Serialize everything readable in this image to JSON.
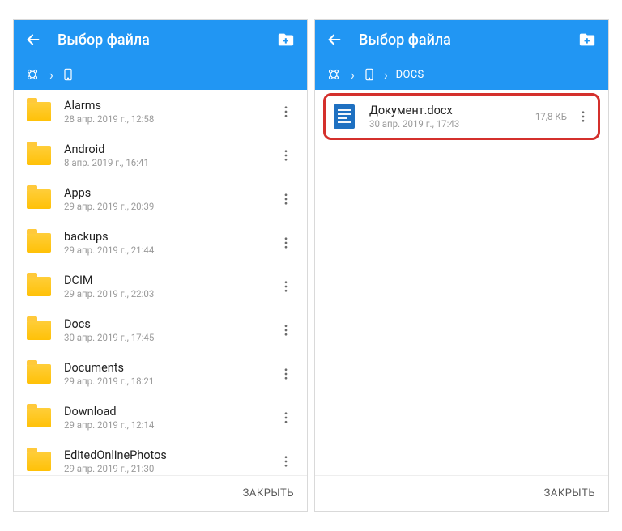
{
  "left": {
    "title": "Выбор файла",
    "breadcrumb": {
      "segments": []
    },
    "items": [
      {
        "name": "Alarms",
        "date": "28 апр. 2019 г., 12:58",
        "type": "folder"
      },
      {
        "name": "Android",
        "date": "8 апр. 2019 г., 16:41",
        "type": "folder"
      },
      {
        "name": "Apps",
        "date": "29 апр. 2019 г., 20:39",
        "type": "folder"
      },
      {
        "name": "backups",
        "date": "29 апр. 2019 г., 21:44",
        "type": "folder"
      },
      {
        "name": "DCIM",
        "date": "29 апр. 2019 г., 22:03",
        "type": "folder"
      },
      {
        "name": "Docs",
        "date": "30 апр. 2019 г., 17:45",
        "type": "folder"
      },
      {
        "name": "Documents",
        "date": "29 апр. 2019 г., 18:21",
        "type": "folder"
      },
      {
        "name": "Download",
        "date": "29 апр. 2019 г., 12:14",
        "type": "folder"
      },
      {
        "name": "EditedOnlinePhotos",
        "date": "29 апр. 2019 г., 21:30",
        "type": "folder"
      }
    ],
    "close": "ЗАКРЫТЬ"
  },
  "right": {
    "title": "Выбор файла",
    "breadcrumb": {
      "segments": [
        "DOCS"
      ]
    },
    "items": [
      {
        "name": "Документ.docx",
        "date": "30 апр. 2019 г., 17:43",
        "size": "17,8 КБ",
        "type": "docx",
        "highlighted": true
      }
    ],
    "close": "ЗАКРЫТЬ"
  }
}
